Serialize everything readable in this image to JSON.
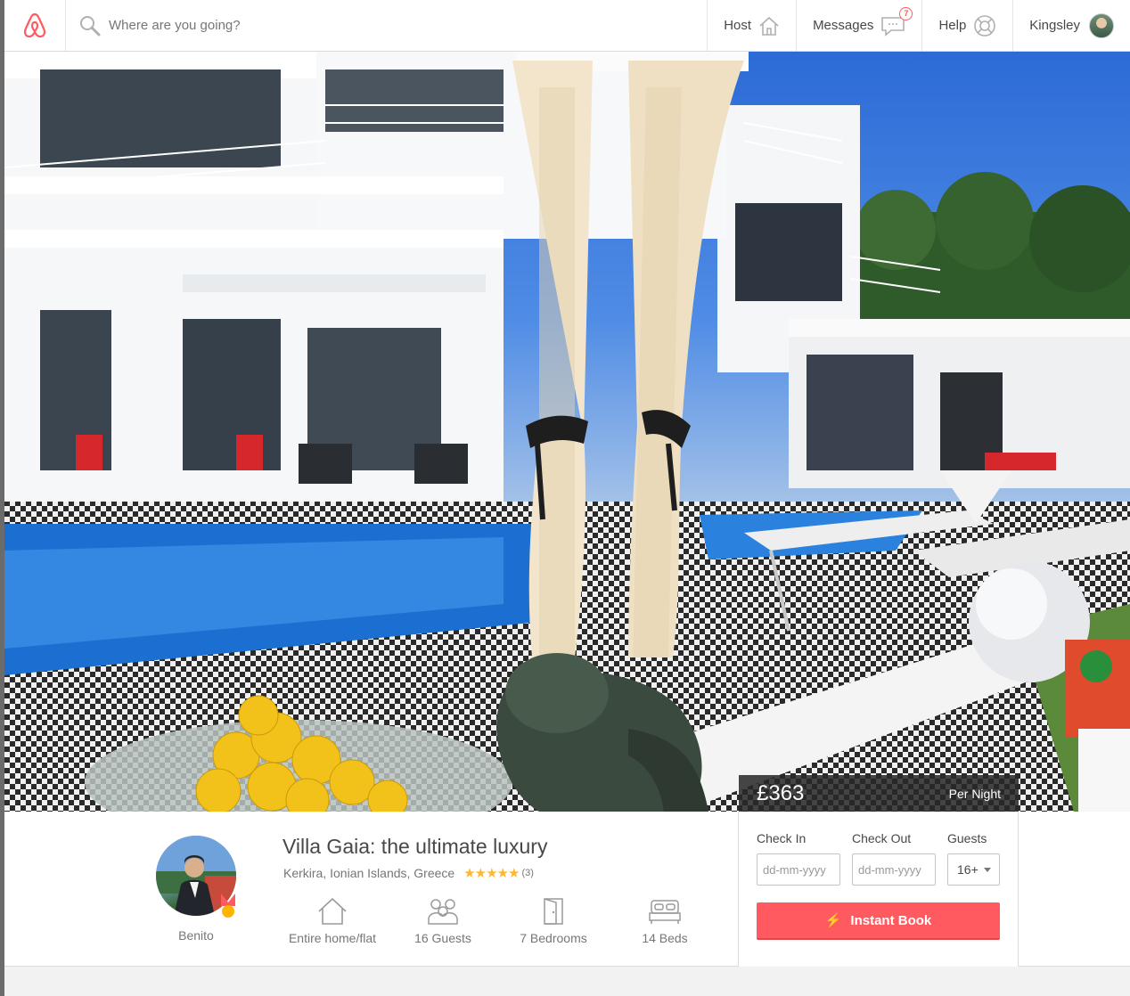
{
  "header": {
    "search_placeholder": "Where are you going?",
    "nav": {
      "host": "Host",
      "messages": "Messages",
      "messages_count": "7",
      "help": "Help",
      "user": "Kingsley"
    }
  },
  "listing": {
    "price": "£363",
    "price_unit": "Per Night",
    "title": "Villa Gaia: the ultimate luxury",
    "location": "Kerkira, Ionian Islands, Greece",
    "rating_stars": "★★★★★",
    "review_count": "(3)",
    "host_name": "Benito",
    "amenities": {
      "type": "Entire home/flat",
      "guests": "16 Guests",
      "bedrooms": "7 Bedrooms",
      "beds": "14 Beds"
    }
  },
  "booking": {
    "check_in_label": "Check In",
    "check_out_label": "Check Out",
    "guests_label": "Guests",
    "date_placeholder": "dd-mm-yyyy",
    "guests_value": "16+",
    "instant_book": "Instant Book"
  },
  "colors": {
    "brand": "#ff5a5f",
    "star": "#fdb833",
    "bolt": "#ffb400"
  }
}
